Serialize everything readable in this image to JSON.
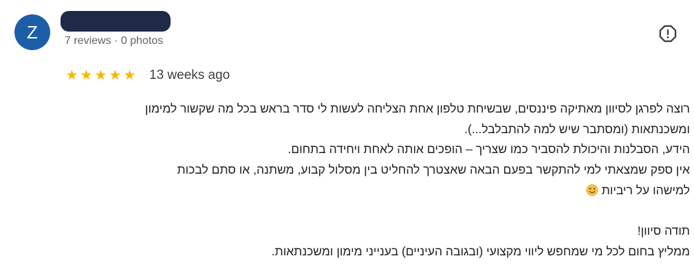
{
  "reviewer": {
    "avatar_initial": "Z",
    "meta": "7 reviews · 0 photos"
  },
  "review": {
    "rating": 5,
    "stars": [
      "★",
      "★",
      "★",
      "★",
      "★"
    ],
    "date": "13 weeks ago",
    "lines": [
      "רוצה לפרגן לסיוון מאתיקה פיננסים, שבשיחת טלפון אחת הצליחה לעשות לי סדר בראש בכל מה שקשור למימון",
      "ומשכנתאות (ומסתבר שיש למה להתבלבל...).",
      "הידע, הסבלנות והיכולת להסביר כמו שצריך – הופכים אותה לאחת ויחידה בתחום.",
      "אין ספק שמצאתי למי להתקשר בפעם הבאה שאצטרך להחליט בין מסלול קבוע, משתנה, או סתם לבכות",
      "למישהו על ריביות",
      "",
      "תודה סיוון!",
      "ממליץ בחום לכל מי שמחפש ליווי מקצועי (ובגובה העיניים) בענייני מימון ומשכנתאות."
    ]
  },
  "icons": {
    "report": "report-flag-icon",
    "emoji": "winking-face-icon"
  },
  "colors": {
    "avatar_bg": "#1c5fa8",
    "star": "#f5b800",
    "secondary_text": "#5f6368",
    "body_text": "#202124"
  }
}
